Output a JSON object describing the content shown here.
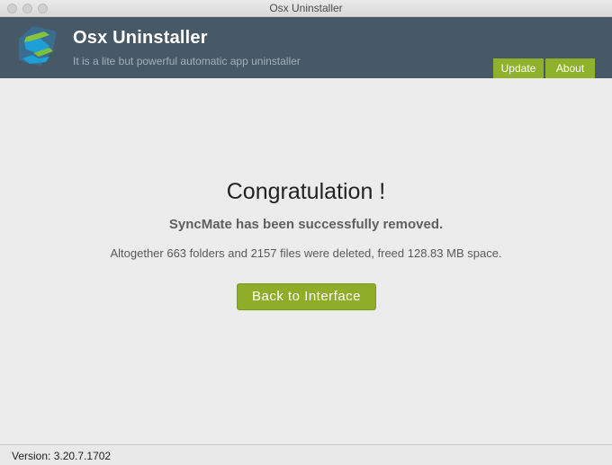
{
  "window": {
    "title": "Osx Uninstaller"
  },
  "header": {
    "app_name": "Osx Uninstaller",
    "tagline": "It is a lite but powerful automatic app uninstaller",
    "logo_icon": "osx-uninstaller-logo-icon",
    "tabs": [
      {
        "label": "Update"
      },
      {
        "label": "About"
      }
    ]
  },
  "main": {
    "heading": "Congratulation !",
    "removed_message": "SyncMate has been successfully removed.",
    "summary": "Altogether 663 folders and 2157 files were deleted, freed 128.83 MB space.",
    "back_button_label": "Back to Interface"
  },
  "statusbar": {
    "version": "Version: 3.20.7.1702"
  },
  "colors": {
    "header_bg": "#475866",
    "accent_green": "#8fb12b",
    "background": "#ececec"
  }
}
